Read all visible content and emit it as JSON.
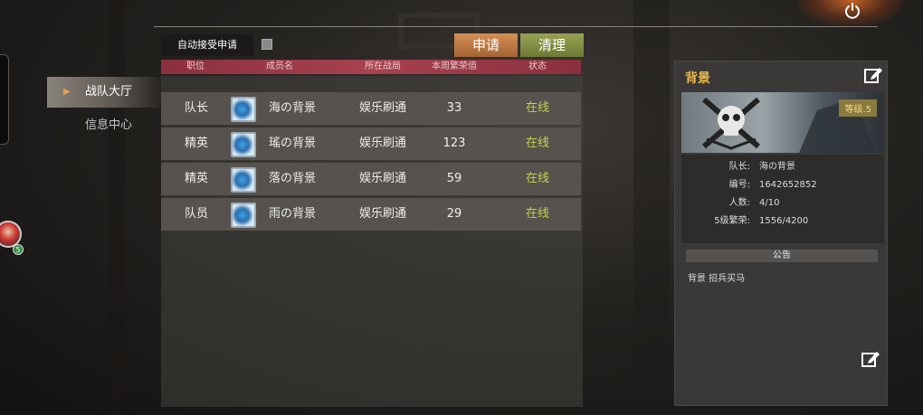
{
  "nav": {
    "items": [
      {
        "label": "战队大厅",
        "active": true
      },
      {
        "label": "信息中心",
        "active": false
      }
    ]
  },
  "auto_accept": {
    "label": "自动接受申请",
    "checked": false
  },
  "buttons": {
    "apply": "申请",
    "clean": "清理"
  },
  "table": {
    "headers": [
      "职位",
      "成员名",
      "所在战局",
      "本周繁荣值",
      "状态"
    ],
    "rows": [
      {
        "rank": "队长",
        "name": "海の背景",
        "region": "娱乐刷通",
        "score": "33",
        "status": "在线"
      },
      {
        "rank": "精英",
        "name": "瑤の背景",
        "region": "娱乐刷通",
        "score": "123",
        "status": "在线"
      },
      {
        "rank": "精英",
        "name": "落の背景",
        "region": "娱乐刷通",
        "score": "59",
        "status": "在线"
      },
      {
        "rank": "队员",
        "name": "雨の背景",
        "region": "娱乐刷通",
        "score": "29",
        "status": "在线"
      }
    ]
  },
  "team": {
    "name": "背景",
    "level": "等级.5",
    "leader_label": "队长:",
    "leader": "海の背景",
    "id_label": "编号:",
    "id": "1642652852",
    "members_label": "人数:",
    "members": "4/10",
    "prosperity_label": "5级繁荣:",
    "prosperity": "1556/4200",
    "notice_header": "公告",
    "notice": "背景 招兵买马"
  },
  "avatar": {
    "badge": "5"
  },
  "colors": {
    "accent_gold": "#e8b64a",
    "online_green": "#c7d349",
    "header_red": "#a84250",
    "apply_orange": "#d48f55",
    "clean_olive": "#98a254"
  },
  "icons": [
    "power-icon",
    "edit-icon",
    "member-avatar-icon",
    "arrow-right-icon",
    "skull-emblem-icon"
  ]
}
